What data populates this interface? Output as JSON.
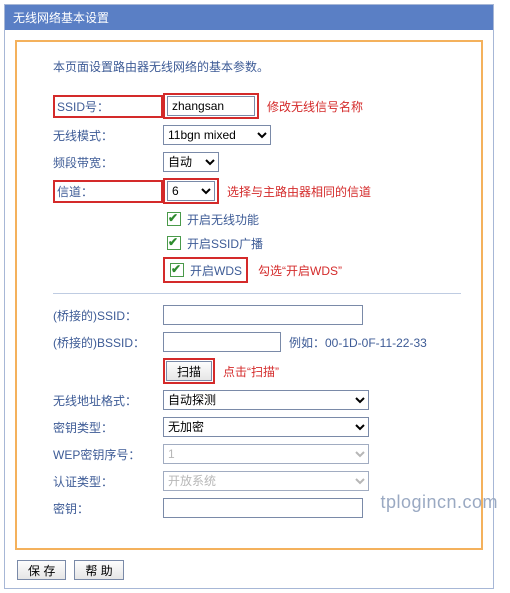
{
  "header": {
    "title": "无线网络基本设置"
  },
  "intro": "本页面设置路由器无线网络的基本参数。",
  "fields": {
    "ssid": {
      "label": "SSID号：",
      "value": "zhangsan",
      "note": "修改无线信号名称"
    },
    "wirelessMode": {
      "label": "无线模式：",
      "value": "11bgn mixed"
    },
    "bandwidth": {
      "label": "频段带宽：",
      "value": "自动"
    },
    "channel": {
      "label": "信道：",
      "value": "6",
      "note": "选择与主路由器相同的信道"
    },
    "enableWireless": {
      "label": "开启无线功能",
      "checked": true
    },
    "enableSsidBroadcast": {
      "label": "开启SSID广播",
      "checked": true
    },
    "enableWds": {
      "label": "开启WDS",
      "checked": true,
      "note": "勾选“开启WDS”"
    },
    "bridgeSsid": {
      "label": "(桥接的)SSID：",
      "value": ""
    },
    "bridgeBssid": {
      "label": "(桥接的)BSSID：",
      "value": "",
      "example": "例如：00-1D-0F-11-22-33"
    },
    "scan": {
      "label": "扫描",
      "note": "点击“扫描”"
    },
    "addrFormat": {
      "label": "无线地址格式：",
      "value": "自动探测"
    },
    "keyType": {
      "label": "密钥类型：",
      "value": "无加密"
    },
    "wepKeyIndex": {
      "label": "WEP密钥序号：",
      "value": "1"
    },
    "authType": {
      "label": "认证类型：",
      "value": "开放系统"
    },
    "key": {
      "label": "密钥：",
      "value": ""
    }
  },
  "footer": {
    "save": "保 存",
    "help": "帮 助"
  },
  "watermark": "tplogincn.com"
}
